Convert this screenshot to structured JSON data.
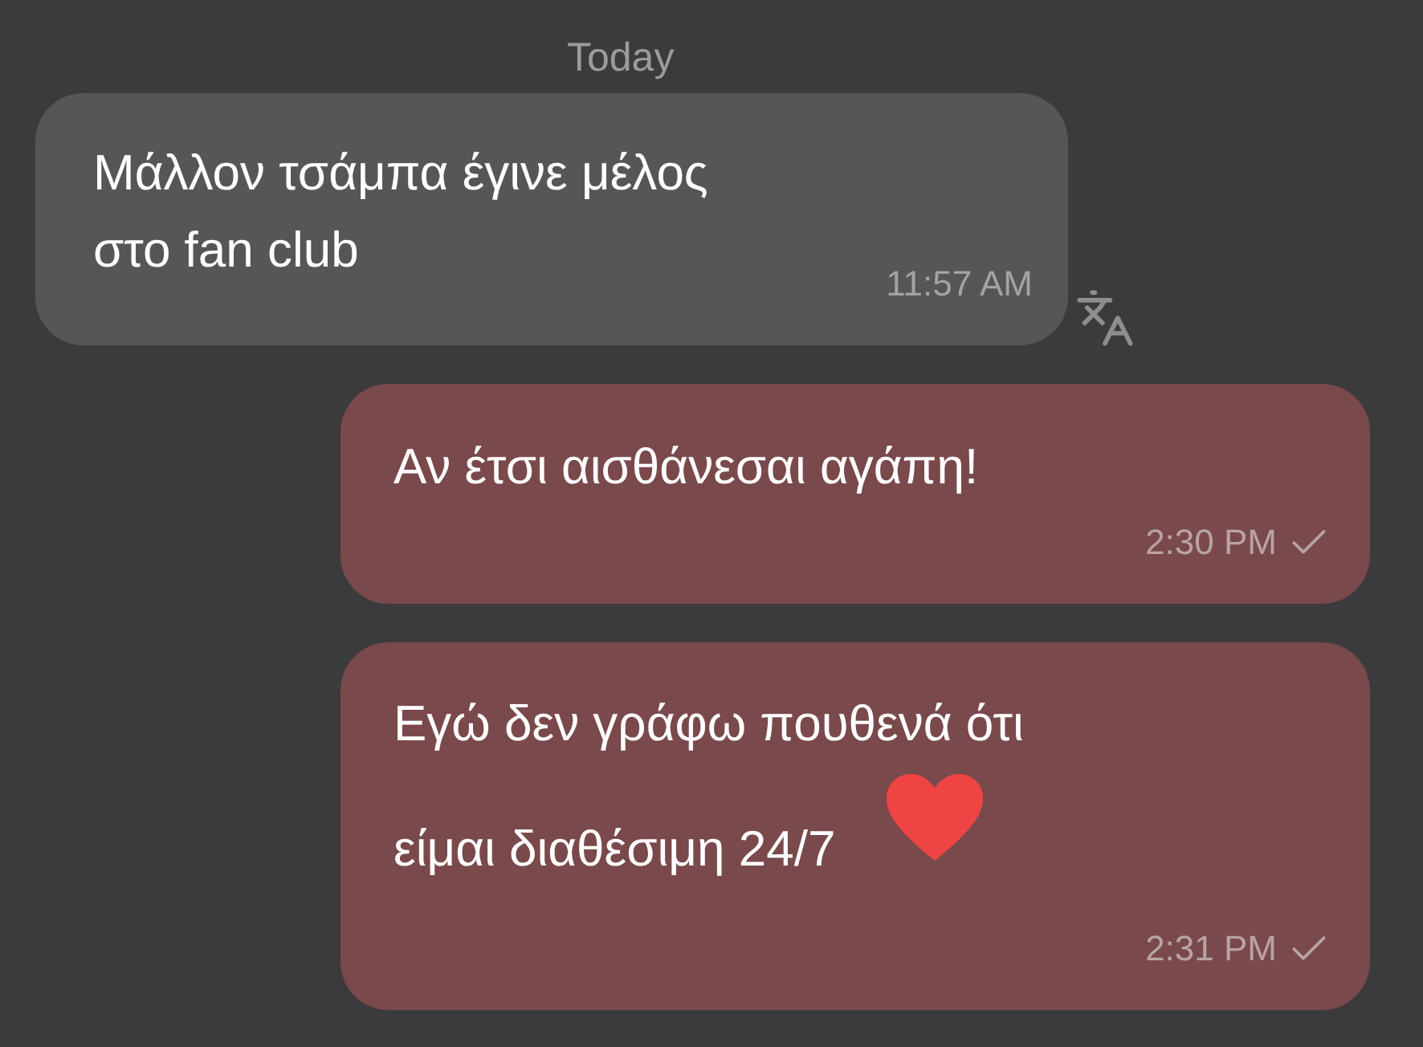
{
  "date_divider": "Today",
  "messages": [
    {
      "kind": "incoming",
      "lines": [
        "Μάλλον τσάμπα έγινε μέλος",
        "στο fan club"
      ],
      "time": "11:57 AM",
      "translate": true
    },
    {
      "kind": "outgoing",
      "lines": [
        "Αν έτσι αισθάνεσαι αγάπη!"
      ],
      "time": "2:30 PM",
      "sent": true
    },
    {
      "kind": "outgoing",
      "lines": [
        "Εγώ δεν γράφω πουθενά ότι",
        "είμαι διαθέσιμη 24/7"
      ],
      "heart": true,
      "time": "2:31 PM",
      "sent": true
    }
  ]
}
